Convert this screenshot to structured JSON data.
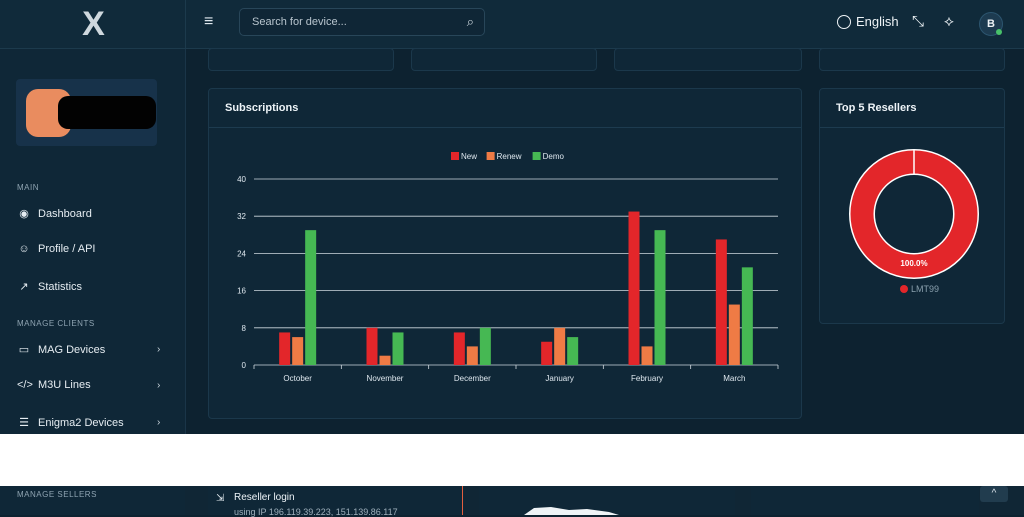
{
  "header": {
    "logo": "X",
    "search_placeholder": "Search for device...",
    "language": "English",
    "avatar_initial": "B"
  },
  "sidebar": {
    "sections": [
      "MAIN",
      "MANAGE CLIENTS",
      "MANAGE SELLERS"
    ],
    "items": [
      {
        "label": "Dashboard"
      },
      {
        "label": "Profile / API"
      },
      {
        "label": "Statistics"
      },
      {
        "label": "MAG Devices"
      },
      {
        "label": "M3U Lines"
      },
      {
        "label": "Enigma2 Devices"
      }
    ]
  },
  "subscriptions": {
    "title": "Subscriptions"
  },
  "resellers": {
    "title": "Top 5 Resellers",
    "percent_label": "100.0%",
    "legend": "LMT99",
    "color": "#e3262a"
  },
  "activity": {
    "title": "Reseller login",
    "detail": "using IP 196.119.39.223, 151.139.86.117"
  },
  "chart_data": {
    "type": "bar",
    "title": "Subscriptions",
    "categories": [
      "October",
      "November",
      "December",
      "January",
      "February",
      "March"
    ],
    "series": [
      {
        "name": "New",
        "color": "#e3262a",
        "values": [
          7,
          8,
          7,
          5,
          33,
          27
        ]
      },
      {
        "name": "Renew",
        "color": "#ef7b45",
        "values": [
          6,
          2,
          4,
          8,
          4,
          13
        ]
      },
      {
        "name": "Demo",
        "color": "#46b853",
        "values": [
          29,
          7,
          8,
          6,
          29,
          21
        ]
      }
    ],
    "ylim": [
      0,
      40
    ],
    "yticks": [
      0,
      8,
      16,
      24,
      32,
      40
    ],
    "legend_position": "top",
    "grid": true
  }
}
